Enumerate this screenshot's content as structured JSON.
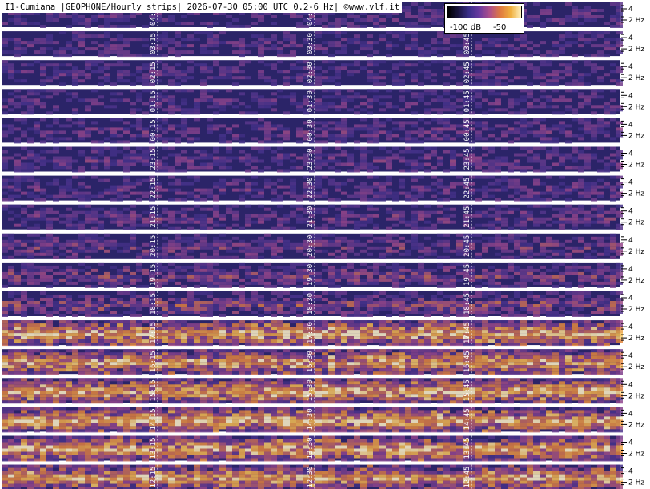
{
  "header": {
    "title": "I1-Cumiana |GEOPHONE/Hourly strips| 2026-07-30 05:00 UTC 0.2-6 Hz| ©www.vlf.it"
  },
  "colorbar": {
    "min_label": "-100 dB",
    "max_label": "-50",
    "colors": [
      "#000000",
      "#1a1540",
      "#3a2f8a",
      "#6a3aa0",
      "#b0508a",
      "#e07a40",
      "#f0b040",
      "#fff2c0"
    ]
  },
  "chart_data": {
    "type": "heatmap",
    "title": "I1-Cumiana |GEOPHONE/Hourly strips| 2026-07-30 05:00 UTC 0.2-6 Hz| ©www.vlf.it",
    "colorbar_range_db": [
      -100,
      -50
    ],
    "freq_range_hz": [
      0.2,
      6
    ],
    "y_ticks": [
      {
        "value": 4,
        "label": "4"
      },
      {
        "value": 2,
        "label": "2 Hz"
      }
    ],
    "strip_hours": [
      "04",
      "03",
      "02",
      "01",
      "00",
      "23",
      "22",
      "21",
      "20",
      "19",
      "18",
      "17",
      "16",
      "15",
      "14",
      "13",
      "12"
    ],
    "strips": [
      {
        "labels": [
          "04:15",
          "04:30",
          "04:45"
        ],
        "activity": 0.15
      },
      {
        "labels": [
          "03:15",
          "03:30",
          "03:45"
        ],
        "activity": 0.15
      },
      {
        "labels": [
          "02:15",
          "02:30",
          "02:45"
        ],
        "activity": 0.15
      },
      {
        "labels": [
          "01:15",
          "01:30",
          "01:45"
        ],
        "activity": 0.15
      },
      {
        "labels": [
          "00:15",
          "00:30",
          "00:45"
        ],
        "activity": 0.2
      },
      {
        "labels": [
          "23:15",
          "23:30",
          "23:45"
        ],
        "activity": 0.2
      },
      {
        "labels": [
          "22:15",
          "22:30",
          "22:45"
        ],
        "activity": 0.2
      },
      {
        "labels": [
          "21:15",
          "21:30",
          "21:45"
        ],
        "activity": 0.25
      },
      {
        "labels": [
          "20:15",
          "20:30",
          "20:45"
        ],
        "activity": 0.3
      },
      {
        "labels": [
          "19:15",
          "19:30",
          "19:45"
        ],
        "activity": 0.35
      },
      {
        "labels": [
          "18:15",
          "18:30",
          "18:45"
        ],
        "activity": 0.45
      },
      {
        "labels": [
          "17:15",
          "17:30",
          "17:45"
        ],
        "activity": 0.8
      },
      {
        "labels": [
          "16:15",
          "16:30",
          "16:45"
        ],
        "activity": 0.75
      },
      {
        "labels": [
          "15:15",
          "15:30",
          "15:45"
        ],
        "activity": 0.8
      },
      {
        "labels": [
          "14:15",
          "14:30",
          "14:45"
        ],
        "activity": 0.8
      },
      {
        "labels": [
          "13:15",
          "13:30",
          "13:45"
        ],
        "activity": 0.75
      },
      {
        "labels": [
          "12:15",
          "12:30",
          "12:45"
        ],
        "activity": 0.75
      }
    ],
    "grid": true
  }
}
